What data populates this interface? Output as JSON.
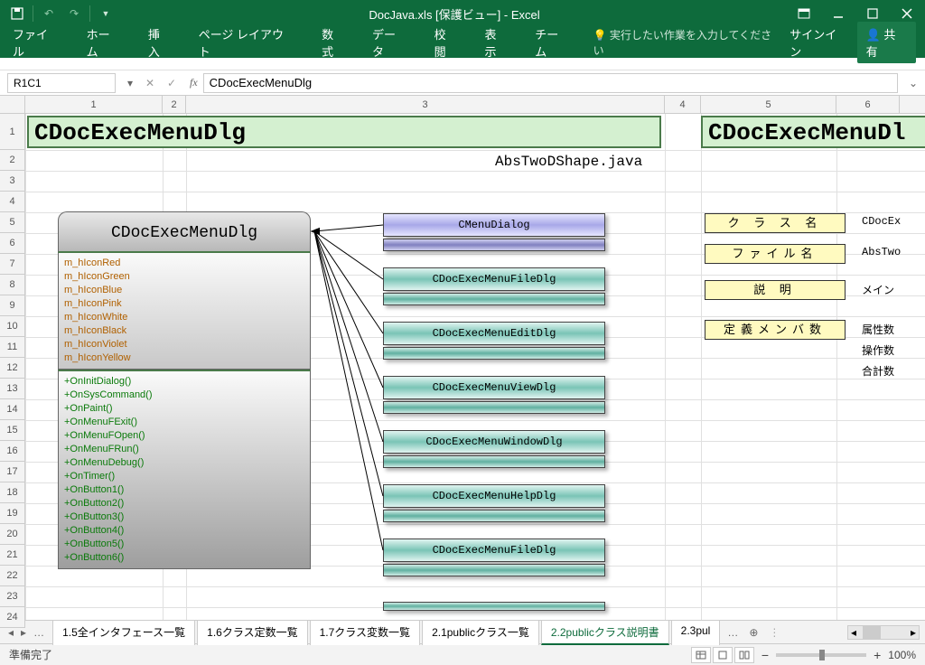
{
  "titlebar": {
    "title": "DocJava.xls  [保護ビュー] - Excel"
  },
  "ribbon": {
    "tabs": [
      "ファイル",
      "ホーム",
      "挿入",
      "ページ レイアウト",
      "数式",
      "データ",
      "校閲",
      "表示",
      "チーム"
    ],
    "tell_me": "実行したい作業を入力してください",
    "signin": "サインイン",
    "share": "共有"
  },
  "fx": {
    "name_box": "R1C1",
    "formula": "CDocExecMenuDlg"
  },
  "cols": [
    "1",
    "2",
    "3",
    "4",
    "5",
    "6"
  ],
  "rows": [
    "1",
    "2",
    "3",
    "4",
    "5",
    "6",
    "7",
    "8",
    "9",
    "10",
    "11",
    "12",
    "13",
    "14",
    "15",
    "16",
    "17",
    "18",
    "19",
    "20",
    "21",
    "22",
    "23",
    "24"
  ],
  "cells": {
    "title": "CDocExecMenuDlg",
    "title2": "CDocExecMenuDl",
    "java_file": "AbsTwoDShape.java"
  },
  "class_box": {
    "name": "CDocExecMenuDlg",
    "attrs": [
      "m_hIconRed",
      "m_hIconGreen",
      "m_hIconBlue",
      "m_hIconPink",
      "m_hIconWhite",
      "m_hIconBlack",
      "m_hIconViolet",
      "m_hIconYellow"
    ],
    "ops": [
      "+OnInitDialog()",
      "+OnSysCommand()",
      "+OnPaint()",
      "+OnMenuFExit()",
      "+OnMenuFOpen()",
      "+OnMenuFRun()",
      "+OnMenuDebug()",
      "+OnTimer()",
      "+OnButton1()",
      "+OnButton2()",
      "+OnButton3()",
      "+OnButton4()",
      "+OnButton5()",
      "+OnButton6()"
    ]
  },
  "relations": [
    "CMenuDialog",
    "CDocExecMenuFileDlg",
    "CDocExecMenuEditDlg",
    "CDocExecMenuViewDlg",
    "CDocExecMenuWindowDlg",
    "CDocExecMenuHelpDlg",
    "CDocExecMenuFileDlg"
  ],
  "labels": [
    "ク ラ ス 名",
    "ファイル名",
    "説    明",
    "定義メンバ数"
  ],
  "side_values": [
    "CDocEx",
    "AbsTwo",
    "メイン",
    "属性数",
    "操作数",
    "合計数"
  ],
  "sheet_tabs": {
    "items": [
      "1.5全インタフェース一覧",
      "1.6クラス定数一覧",
      "1.7クラス変数一覧",
      "2.1publicクラス一覧",
      "2.2publicクラス説明書",
      "2.3pul"
    ],
    "active": 4
  },
  "status": {
    "ready": "準備完了",
    "zoom": "100%"
  }
}
